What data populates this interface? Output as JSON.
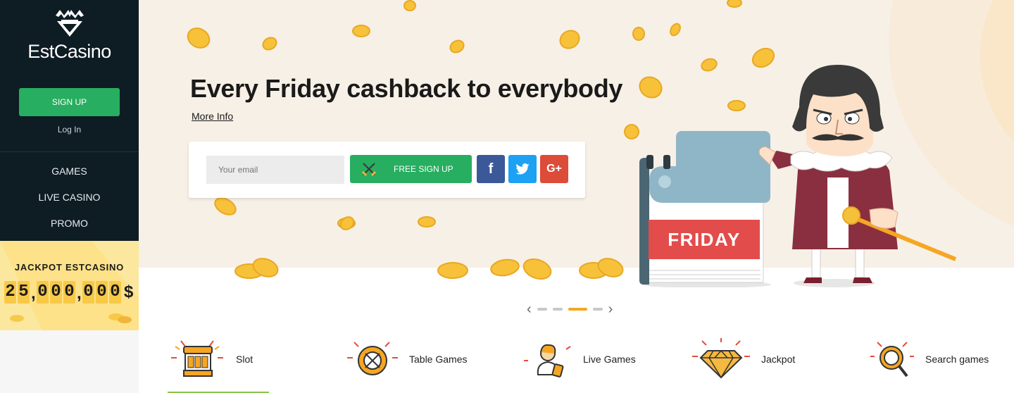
{
  "brand": {
    "name": "EstCasino"
  },
  "sidebar": {
    "signup_label": "SIGN UP",
    "login_label": "Log In",
    "nav": [
      {
        "label": "GAMES"
      },
      {
        "label": "LIVE CASINO"
      },
      {
        "label": "PROMO"
      }
    ]
  },
  "jackpot": {
    "title": "JACKPOT ESTCASINO",
    "digits": [
      "2",
      "5",
      "0",
      "0",
      "0",
      "0",
      "0",
      "0"
    ],
    "currency": "$"
  },
  "hero": {
    "title": "Every Friday cashback to everybody",
    "more_info": "More Info",
    "calendar_day": "FRIDAY"
  },
  "form": {
    "email_placeholder": "Your email",
    "free_signup_label": "FREE SIGN UP",
    "social": [
      {
        "name": "facebook",
        "glyph": "f"
      },
      {
        "name": "twitter",
        "glyph": "t"
      },
      {
        "name": "google-plus",
        "glyph": "G+"
      }
    ]
  },
  "carousel": {
    "slide_count": 4,
    "active_index": 2
  },
  "categories": [
    {
      "label": "Slot",
      "icon": "slot-machine-icon"
    },
    {
      "label": "Table Games",
      "icon": "roulette-icon"
    },
    {
      "label": "Live Games",
      "icon": "live-dealer-icon"
    },
    {
      "label": "Jackpot",
      "icon": "diamond-icon"
    },
    {
      "label": "Search games",
      "icon": "magnifier-icon"
    }
  ],
  "colors": {
    "sidebar_bg": "#0e1c24",
    "accent_green": "#27ae60",
    "jackpot_bg": "#fde28a",
    "facebook": "#3b5998",
    "twitter": "#1da1f2",
    "google": "#dd4b39",
    "friday_red": "#e24c4b"
  }
}
